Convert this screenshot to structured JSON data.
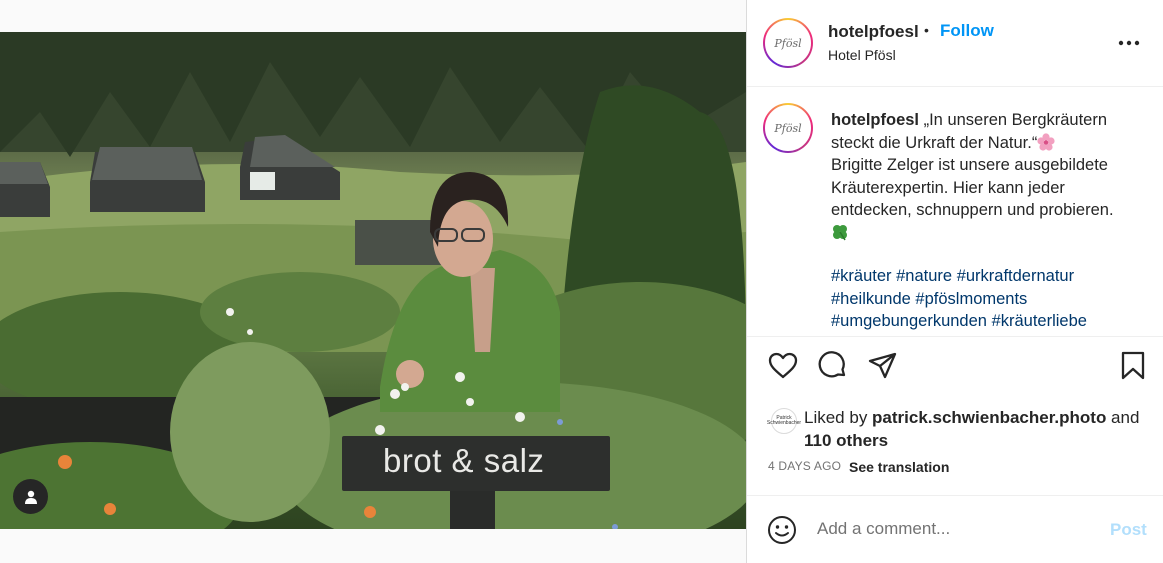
{
  "post": {
    "username": "hotelpfoesl",
    "separator": "•",
    "follow_label": "Follow",
    "location": "Hotel Pfösl",
    "avatar_text": "Pfösl",
    "more_icon": "more-horizontal-icon",
    "caption": {
      "username": "hotelpfoesl",
      "line1": " „In unseren Bergkräutern steckt die Urkraft der Natur.“",
      "line2": "Brigitte Zelger ist unsere ausgebildete Kräuterexpertin. Hier kann jeder entdecken, schnuppern und probieren.",
      "hashtags": [
        "#kräuter",
        "#nature",
        "#urkraftdernatur",
        "#heilkunde",
        "#pföslmoments",
        "#umgebungerkunden",
        "#kräuterliebe"
      ]
    },
    "photo": {
      "sign_text": "brot & salz"
    },
    "actions": {
      "like_icon": "heart-icon",
      "comment_icon": "comment-icon",
      "share_icon": "send-icon",
      "save_icon": "bookmark-icon"
    },
    "likes": {
      "prefix": "Liked by ",
      "user": "patrick.schwienbacher.photo",
      "middle": " and ",
      "others": "110 others",
      "avatar_text": "Patrick Schwienbacher"
    },
    "timestamp": "4 DAYS AGO",
    "see_translation": "See translation",
    "comment": {
      "placeholder": "Add a comment...",
      "post_label": "Post"
    },
    "colors": {
      "follow": "#0095f6",
      "hashtag": "#00376b",
      "post_disabled": "#b2dffc"
    }
  }
}
